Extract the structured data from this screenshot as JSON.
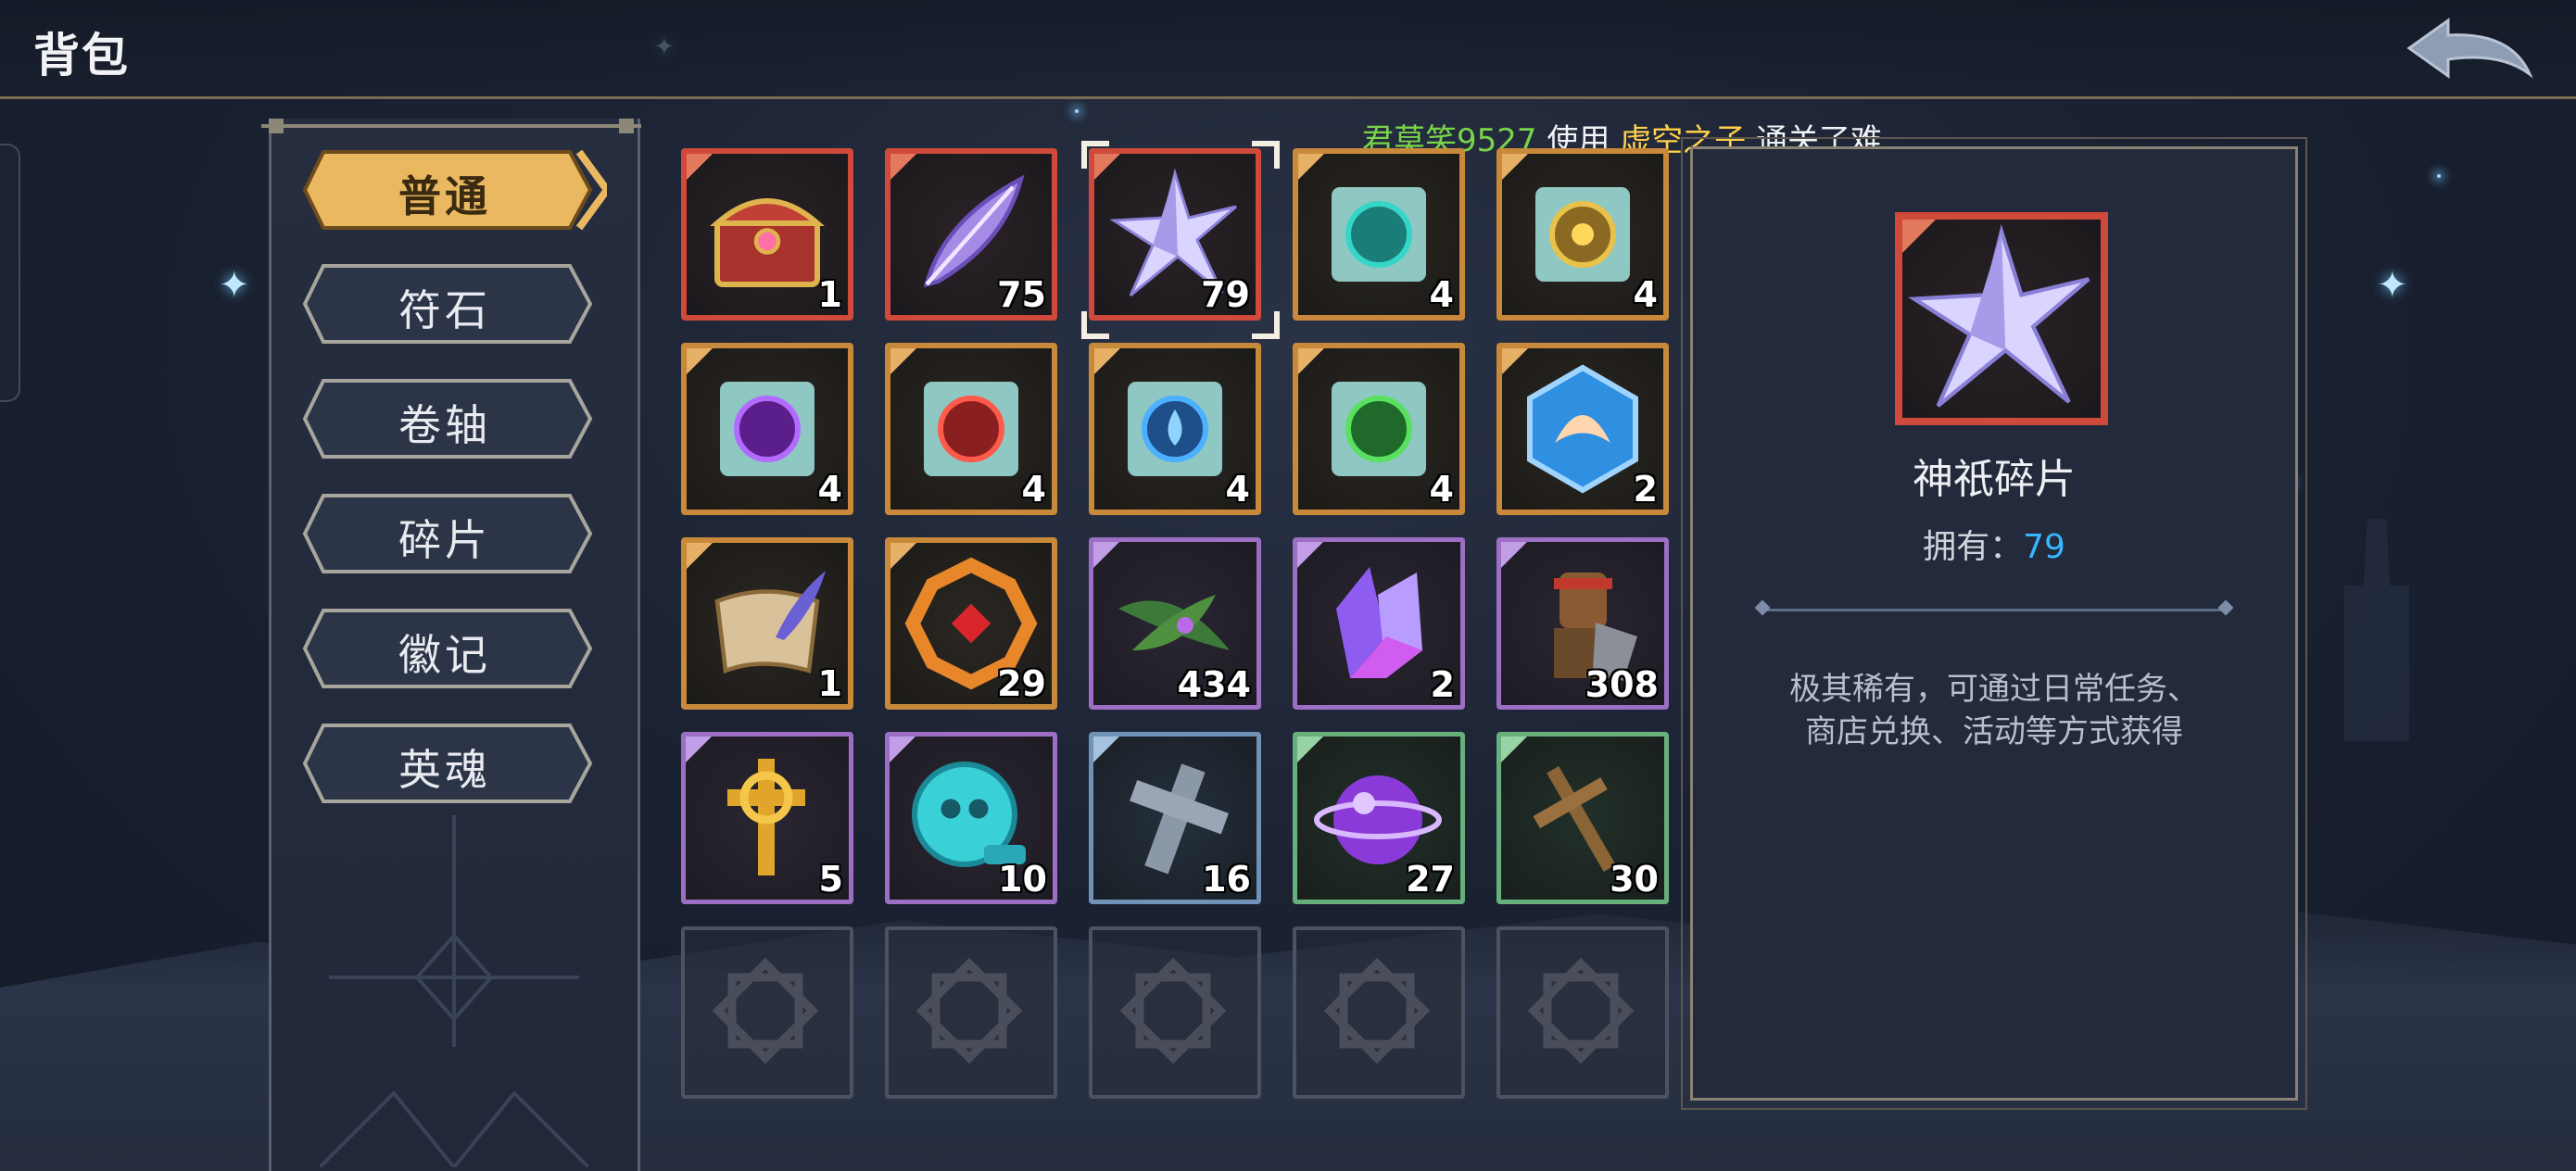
{
  "header": {
    "title": "背包"
  },
  "broadcast": {
    "player": "君莫笑9527",
    "action": "使用",
    "hero": "虚空之子",
    "result": "通关了难"
  },
  "tabs": [
    {
      "label": "普通",
      "active": true
    },
    {
      "label": "符石",
      "active": false
    },
    {
      "label": "卷轴",
      "active": false
    },
    {
      "label": "碎片",
      "active": false
    },
    {
      "label": "徽记",
      "active": false
    },
    {
      "label": "英魂",
      "active": false
    }
  ],
  "items": [
    {
      "icon": "treasure-chest-icon",
      "rarity": "red",
      "qty": "1"
    },
    {
      "icon": "purple-feather-icon",
      "rarity": "red",
      "qty": "75"
    },
    {
      "icon": "crystal-star-shard-icon",
      "rarity": "red",
      "qty": "79",
      "selected": true
    },
    {
      "icon": "teal-rune-scroll-icon",
      "rarity": "gold",
      "qty": "4"
    },
    {
      "icon": "gold-sun-rune-scroll-icon",
      "rarity": "gold",
      "qty": "4"
    },
    {
      "icon": "purple-rune-scroll-icon",
      "rarity": "gold",
      "qty": "4"
    },
    {
      "icon": "red-flame-rune-scroll-icon",
      "rarity": "gold",
      "qty": "4"
    },
    {
      "icon": "blue-water-rune-scroll-icon",
      "rarity": "gold",
      "qty": "4"
    },
    {
      "icon": "green-leaf-rune-scroll-icon",
      "rarity": "gold",
      "qty": "4"
    },
    {
      "icon": "blue-phoenix-emblem-icon",
      "rarity": "gold",
      "qty": "2"
    },
    {
      "icon": "quill-scroll-icon",
      "rarity": "gold",
      "qty": "1"
    },
    {
      "icon": "orange-gem-amulet-icon",
      "rarity": "gold",
      "qty": "29"
    },
    {
      "icon": "green-leaf-herb-icon",
      "rarity": "purple",
      "qty": "434"
    },
    {
      "icon": "purple-crystal-cluster-icon",
      "rarity": "purple",
      "qty": "2"
    },
    {
      "icon": "wooden-warrior-icon",
      "rarity": "purple",
      "qty": "308"
    },
    {
      "icon": "golden-cross-icon",
      "rarity": "purple",
      "qty": "5"
    },
    {
      "icon": "cyan-skull-coin-icon",
      "rarity": "purple",
      "qty": "10"
    },
    {
      "icon": "stone-cross-icon",
      "rarity": "blue",
      "qty": "16"
    },
    {
      "icon": "purple-orb-icon",
      "rarity": "green",
      "qty": "27"
    },
    {
      "icon": "wooden-cross-icon",
      "rarity": "green",
      "qty": "30"
    },
    {
      "icon": "empty-slot-icon",
      "rarity": "empty",
      "qty": ""
    },
    {
      "icon": "empty-slot-icon",
      "rarity": "empty",
      "qty": ""
    },
    {
      "icon": "empty-slot-icon",
      "rarity": "empty",
      "qty": ""
    },
    {
      "icon": "empty-slot-icon",
      "rarity": "empty",
      "qty": ""
    },
    {
      "icon": "empty-slot-icon",
      "rarity": "empty",
      "qty": ""
    }
  ],
  "detail": {
    "name": "神祇碎片",
    "owned_label": "拥有：",
    "owned_count": "79",
    "description_line1": "极其稀有，可通过日常任务、",
    "description_line2": "商店兑换、活动等方式获得"
  },
  "colors": {
    "red": "#cf4a3a",
    "gold": "#c8893a",
    "purple": "#9c6fc4",
    "blue": "#6f92b6",
    "green": "#67b07c",
    "owned_count": "#38b6ff"
  }
}
